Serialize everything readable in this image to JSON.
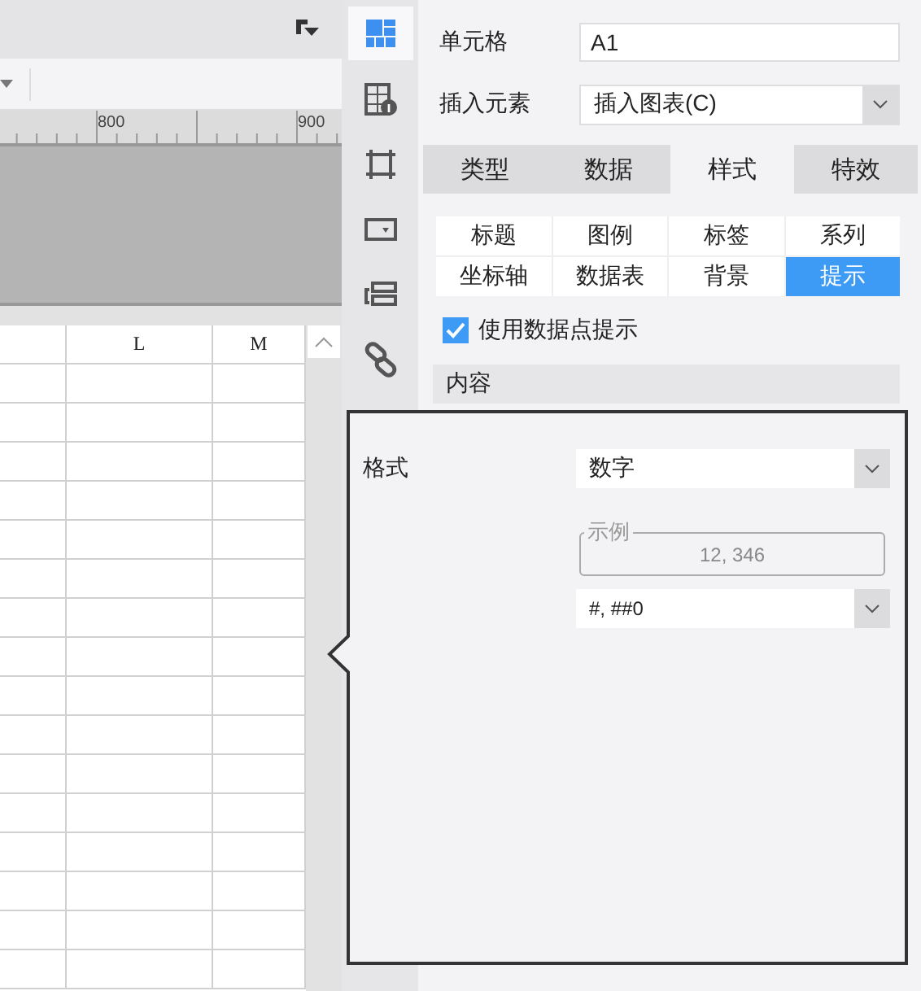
{
  "ruler": {
    "ticks": [
      "800",
      "900"
    ]
  },
  "sheet": {
    "columns": [
      "L",
      "M"
    ]
  },
  "side_icons": [
    {
      "kind": "layout",
      "selected": true
    },
    {
      "kind": "table-info",
      "selected": false
    },
    {
      "kind": "frame",
      "selected": false
    },
    {
      "kind": "dropdown",
      "selected": false
    },
    {
      "kind": "form",
      "selected": false
    },
    {
      "kind": "link",
      "selected": false
    }
  ],
  "panel": {
    "fields": [
      {
        "kind": "text",
        "label": "单元格",
        "value": "A1"
      },
      {
        "kind": "select",
        "label": "插入元素",
        "value": "插入图表(C)"
      }
    ],
    "tabs": [
      {
        "label": "类型",
        "selected": false
      },
      {
        "label": "数据",
        "selected": false
      },
      {
        "label": "样式",
        "selected": true
      },
      {
        "label": "特效",
        "selected": false
      }
    ],
    "subtabs": [
      {
        "label": "标题",
        "selected": false
      },
      {
        "label": "图例",
        "selected": false
      },
      {
        "label": "标签",
        "selected": false
      },
      {
        "label": "系列",
        "selected": false
      },
      {
        "label": "坐标轴",
        "selected": false
      },
      {
        "label": "数据表",
        "selected": false
      },
      {
        "label": "背景",
        "selected": false
      },
      {
        "label": "提示",
        "selected": true
      }
    ],
    "checkbox": {
      "label": "使用数据点提示",
      "checked": true
    },
    "section": "内容"
  },
  "popup": {
    "format_label": "格式",
    "format_value": "数字",
    "example_legend": "示例",
    "example_value": "12, 346",
    "pattern": "#, ##0"
  }
}
